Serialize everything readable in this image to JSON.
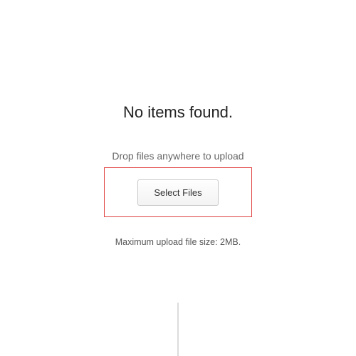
{
  "empty_state": {
    "heading": "No items found."
  },
  "uploader": {
    "drop_hint": "Drop files anywhere to upload",
    "select_label": "Select Files",
    "max_size_text": "Maximum upload file size: 2MB."
  }
}
